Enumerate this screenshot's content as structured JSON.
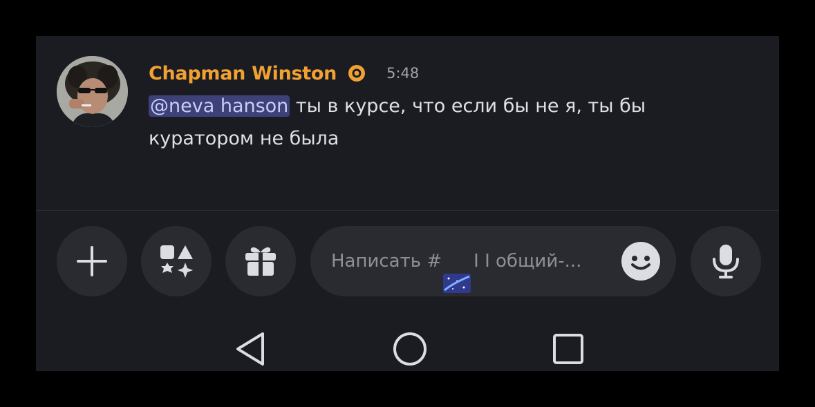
{
  "message": {
    "author": "Chapman Winston",
    "timestamp": "5:48",
    "mention": "@neva hanson",
    "text": " ты в курсе, что если бы не я, ты бы куратором не была",
    "author_color": "#f0a132",
    "mention_bg": "#3d4177"
  },
  "icons": {
    "badge": "server-boost-badge-icon",
    "add": "plus-icon",
    "apps": "apps-icon",
    "gift": "gift-icon",
    "emoji": "emoji-smile-icon",
    "mic": "microphone-icon"
  },
  "composer": {
    "placeholder_prefix": "Написать #",
    "placeholder_suffix": "I I общий-..."
  },
  "navbar": {
    "back": "back-triangle-icon",
    "home": "home-circle-icon",
    "recents": "recents-square-icon"
  },
  "colors": {
    "background": "#1b1c21",
    "button_bg": "#2a2b31",
    "text": "#dfe0e5",
    "muted": "#8e9098"
  }
}
